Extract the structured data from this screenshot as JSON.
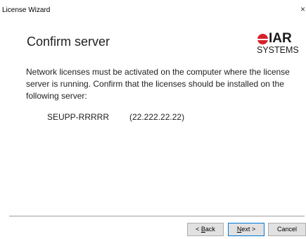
{
  "window": {
    "title": "License Wizard",
    "close_glyph": "×"
  },
  "header": {
    "title": "Confirm server",
    "logo": {
      "top_text": "IAR",
      "bottom_text": "SYSTEMS",
      "brand_color": "#d6202a"
    }
  },
  "main": {
    "description": "Network licenses must be activated on the computer where the license server is running. Confirm that the licenses should be installed on the following server:",
    "server": {
      "name": "SEUPP-RRRRR",
      "address": "(22.222.22.22)"
    }
  },
  "buttons": {
    "back": {
      "pre": "< ",
      "mnemonic": "B",
      "rest": "ack"
    },
    "next": {
      "mnemonic": "N",
      "rest": "ext >"
    },
    "cancel": {
      "label": "Cancel"
    }
  }
}
